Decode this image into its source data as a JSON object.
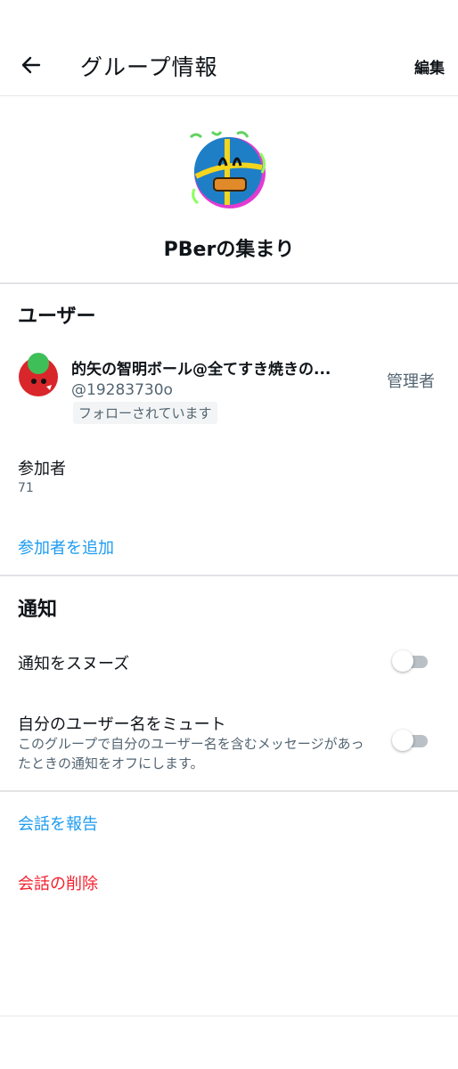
{
  "header": {
    "title": "グループ情報",
    "edit_label": "編集",
    "back_icon": "arrow-left-icon"
  },
  "group": {
    "name": "PBerの集まり"
  },
  "users_section": {
    "title": "ユーザー",
    "admin": {
      "name": "的矢の智明ボール@全てすき焼きの...",
      "handle": "@19283730o",
      "badge": "フォローされています",
      "role": "管理者"
    },
    "participants_label": "参加者",
    "participants_count": "71",
    "add_participants": "参加者を追加"
  },
  "notifications_section": {
    "title": "通知",
    "snooze_label": "通知をスヌーズ",
    "snooze_on": false,
    "mute_label": "自分のユーザー名をミュート",
    "mute_desc": "このグループで自分のユーザー名を含むメッセージがあったときの通知をオフにします。",
    "mute_on": false
  },
  "actions": {
    "report": "会話を報告",
    "delete": "会話の削除"
  },
  "colors": {
    "link": "#1d9bf0",
    "danger": "#f4212e",
    "muted_text": "#536471"
  }
}
